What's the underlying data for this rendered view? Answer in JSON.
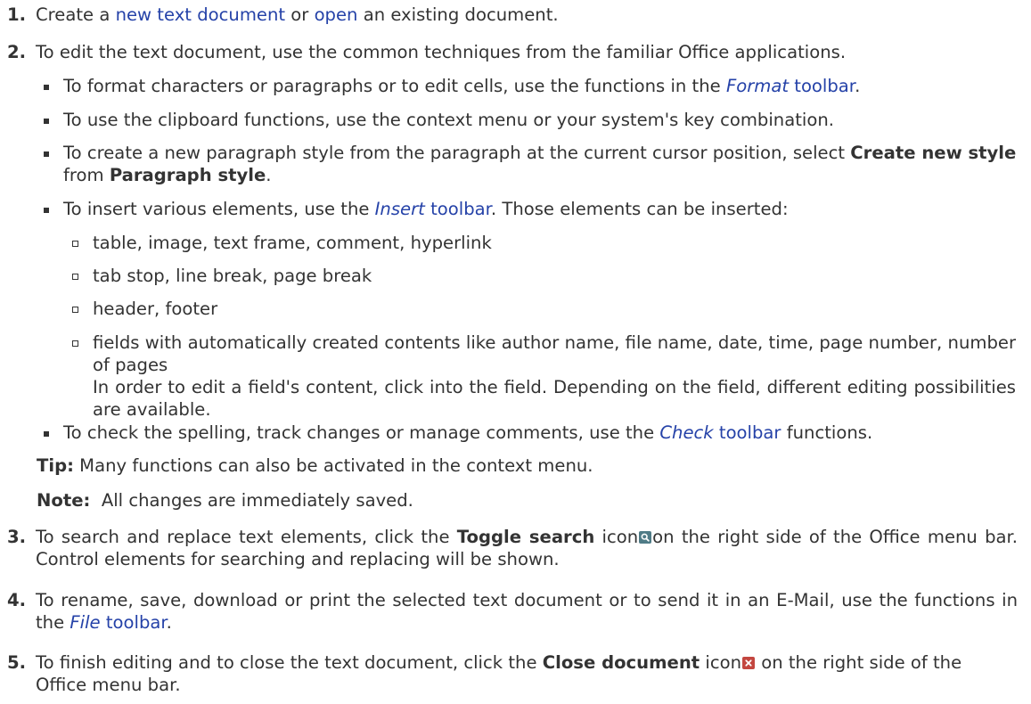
{
  "steps": [
    {
      "number": "1.",
      "parts": [
        "Create a ",
        "new text document",
        " or ",
        "open",
        " an existing document."
      ]
    },
    {
      "number": "2.",
      "text": "To edit the text document, use the common techniques from the familiar Office applications.",
      "bullets": [
        {
          "parts": [
            "To format characters or paragraphs or to edit cells, use the functions in the ",
            "Format",
            " toolbar",
            "."
          ]
        },
        {
          "text": "To use the clipboard functions, use the context menu or your system's key combination."
        },
        {
          "parts": [
            "To create a new paragraph style from the paragraph at the current cursor position, select ",
            "Create new style",
            " from ",
            "Paragraph style",
            "."
          ]
        },
        {
          "parts": [
            "To insert various elements, use the ",
            "Insert",
            " toolbar",
            ". Those elements can be inserted:"
          ],
          "sub_items": [
            "table, image, text frame, comment, hyperlink",
            "tab stop, line break, page break",
            "header, footer",
            "fields with automatically created contents like author name, file name, date, time, page number, number of pages"
          ],
          "field_note": "In order to edit a field's content, click into the field. Depending on the field, different editing possibilities are available."
        },
        {
          "parts": [
            "To check the spelling, track changes or manage comments, use the ",
            "Check",
            " toolbar",
            " functions."
          ]
        }
      ],
      "tip": {
        "label": "Tip:",
        "text": " Many functions can also be activated in the context menu."
      },
      "note": {
        "label": "Note:",
        "text": "  All changes are immediately saved."
      }
    },
    {
      "number": "3.",
      "parts": [
        "To search and replace text elements, click the ",
        "Toggle search",
        " icon",
        "on the right side of the Office menu bar. Control elements for searching and replacing will be shown."
      ],
      "icon": "search-icon"
    },
    {
      "number": "4.",
      "parts": [
        "To rename, save, download or print the selected text document or to send it in an E-Mail, use the functions in the ",
        "File",
        " toolbar",
        "."
      ]
    },
    {
      "number": "5.",
      "parts": [
        "To finish editing and to close the text document, click the ",
        "Close document",
        " icon",
        " on the right side of the Office menu bar."
      ],
      "icon": "close-icon"
    }
  ],
  "colors": {
    "text": "#333333",
    "link": "#2542a8",
    "search_icon": "#4f7b86",
    "close_icon": "#c3463f"
  }
}
